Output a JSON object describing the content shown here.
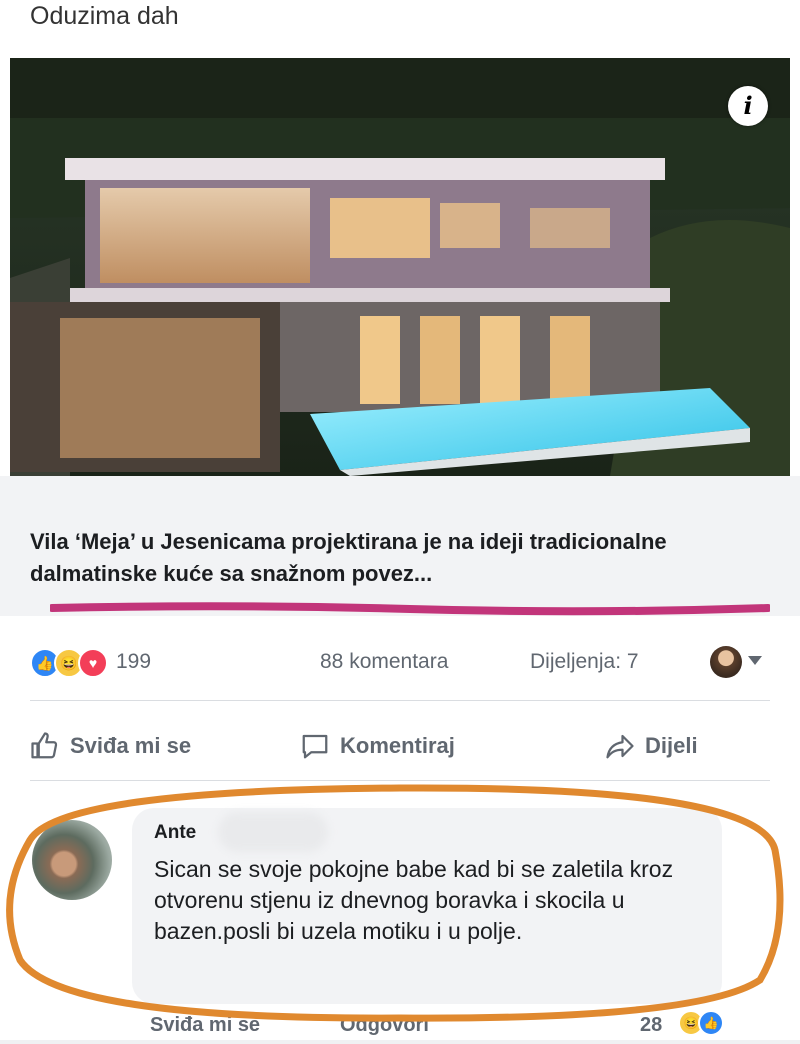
{
  "post": {
    "text": "Oduzima dah"
  },
  "link": {
    "title": "Vila ‘Meja’ u Jesenicama projektirana je na ideji tradicionalne dalmatinske kuće sa snažnom povez..."
  },
  "stats": {
    "reactions_count": "199",
    "comments": "88 komentara",
    "shares": "Dijeljenja: 7"
  },
  "actions": {
    "like": "Sviđa mi se",
    "comment": "Komentiraj",
    "share": "Dijeli"
  },
  "comment": {
    "author": "Ante",
    "text": "Sican se svoje pokojne babe kad bi se zaletila kroz otvorenu stjenu iz dnevnog boravka i skocila u bazen.posli bi uzela motiku i u polje.",
    "like_label": "Sviđa mi se",
    "reply_label": "Odgovori",
    "reaction_count": "28"
  },
  "colors": {
    "underline_mark": "#c2357a",
    "circle_mark": "#e0892f",
    "like_blue": "#2e86f5",
    "love_red": "#f33e58",
    "haha_yellow": "#f7c843"
  },
  "icons": {
    "info": "info-icon",
    "like": "thumbs-up-icon",
    "comment": "speech-bubble-icon",
    "share": "share-arrow-icon"
  }
}
